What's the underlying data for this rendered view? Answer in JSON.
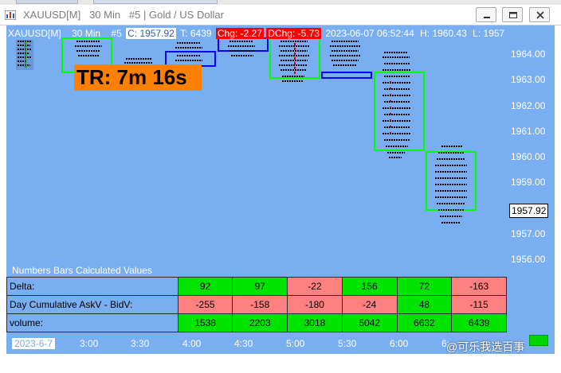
{
  "window": {
    "title": "XAUUSD[M]   30 Min   #5 | Gold / US Dollar"
  },
  "infobar": {
    "symbol": "XAUUSD[M]",
    "timeframe": "30 Min",
    "bars": "#5",
    "close": "C: 1957.92",
    "ticks": "T: 6439",
    "chg": "Chg: -2.27",
    "dchg": "DChg: -5.73",
    "datetime": "2023-06-07 06:52:44",
    "high": "H: 1960.43",
    "low": "L: 1957"
  },
  "timer": {
    "label": "TR: 7m 16s"
  },
  "price_axis": {
    "labels": [
      "1964.00",
      "1963.00",
      "1962.00",
      "1961.00",
      "1960.00",
      "1959.00",
      "1957.00",
      "1956.00"
    ],
    "current": "1957.92"
  },
  "panel": {
    "title": "Numbers Bars Calculated Values",
    "rows": [
      {
        "label": "Delta:",
        "values": [
          "92",
          "97",
          "-22",
          "156",
          "72",
          "-163"
        ],
        "colors": [
          "g",
          "g",
          "r",
          "g",
          "g",
          "r"
        ]
      },
      {
        "label": "Day Cumulative AskV - BidV:",
        "values": [
          "-255",
          "-158",
          "-180",
          "-24",
          "48",
          "-115"
        ],
        "colors": [
          "r",
          "r",
          "r",
          "r",
          "g",
          "r"
        ]
      },
      {
        "label": "volume:",
        "values": [
          "1538",
          "2203",
          "3018",
          "5042",
          "6632",
          "6439"
        ],
        "colors": [
          "g",
          "g",
          "g",
          "g",
          "g",
          "g"
        ]
      }
    ]
  },
  "time_axis": {
    "labels": [
      "2023-6-7",
      "3:00",
      "3:30",
      "4:00",
      "4:30",
      "5:00",
      "5:30",
      "6:00",
      "6:"
    ]
  },
  "watermark": "@可乐我选百事",
  "colors": {
    "background": "#79aef0",
    "positive": "#00e400",
    "negative": "#ff8080",
    "timer": "#ff8000",
    "box_up": "#00ff00",
    "box_down": "#0000ff"
  }
}
